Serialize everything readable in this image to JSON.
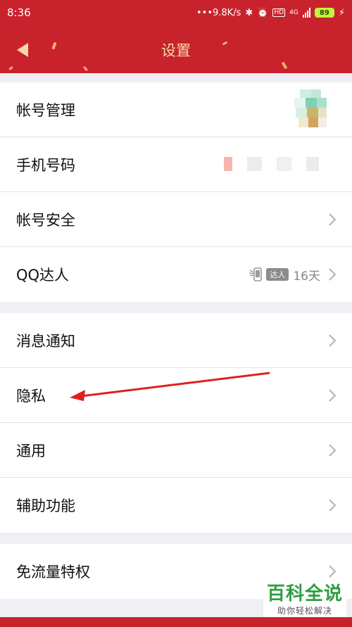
{
  "status_bar": {
    "time": "8:36",
    "speed": "•••9.8K/s",
    "network": "4G",
    "battery": "89"
  },
  "header": {
    "title": "设置"
  },
  "groups": [
    {
      "items": [
        {
          "label": "帐号管理"
        },
        {
          "label": "手机号码"
        },
        {
          "label": "帐号安全"
        },
        {
          "label": "QQ达人",
          "badge": "达人",
          "value": "16天"
        }
      ]
    },
    {
      "items": [
        {
          "label": "消息通知"
        },
        {
          "label": "隐私"
        },
        {
          "label": "通用"
        },
        {
          "label": "辅助功能"
        }
      ]
    },
    {
      "items": [
        {
          "label": "免流量特权"
        }
      ]
    }
  ],
  "watermark": {
    "title": "百科全说",
    "subtitle": "助你轻松解决"
  },
  "colors": {
    "brand_red": "#c8232c",
    "title_gold": "#f4d9a6",
    "watermark_green": "#2f9d42"
  }
}
